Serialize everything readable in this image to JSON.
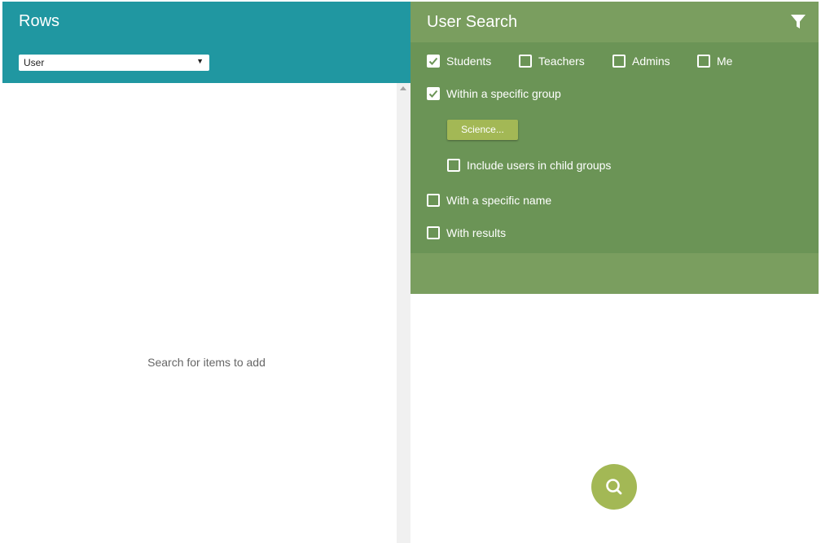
{
  "left": {
    "title": "Rows",
    "type_select": {
      "value": "User"
    },
    "empty_message": "Search for items to add"
  },
  "right": {
    "title": "User Search",
    "filters": {
      "students": {
        "label": "Students",
        "checked": true
      },
      "teachers": {
        "label": "Teachers",
        "checked": false
      },
      "admins": {
        "label": "Admins",
        "checked": false
      },
      "me": {
        "label": "Me",
        "checked": false
      },
      "specific_group": {
        "label": "Within a specific group",
        "checked": true
      },
      "group_button": "Science...",
      "child_groups": {
        "label": "Include users in child groups",
        "checked": false
      },
      "specific_name": {
        "label": "With a specific name",
        "checked": false
      },
      "with_results": {
        "label": "With results",
        "checked": false
      }
    }
  },
  "colors": {
    "left_header": "#2097a1",
    "right_header": "#7a9e5f",
    "options_bg": "#6b9456",
    "accent": "#a3b855"
  },
  "icons": {
    "filter": "filter-icon",
    "search": "search-icon",
    "dropdown": "chevron-down-icon",
    "scroll_up": "scroll-up-arrow-icon"
  }
}
